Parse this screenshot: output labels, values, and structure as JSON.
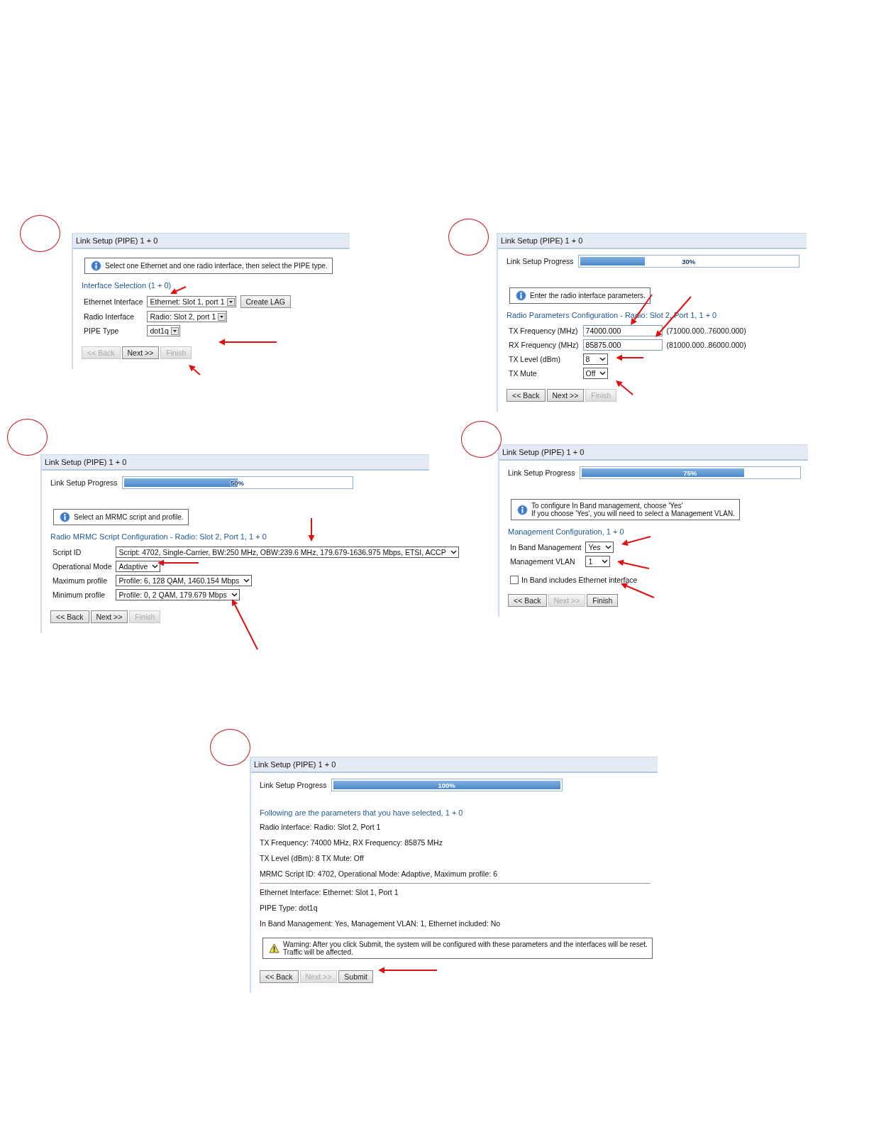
{
  "panels": [
    {
      "title": "Link Setup (PIPE) 1 + 0",
      "blocks": [
        {
          "kind": "info",
          "lines": [
            "Select one Ethernet and one radio interface, then select the PIPE type."
          ]
        },
        {
          "kind": "heading",
          "text": "Interface Selection (1 + 0)"
        },
        {
          "kind": "combo",
          "label": "Ethernet Interface",
          "value": "Ethernet: Slot 1, port 1",
          "action": "Create LAG"
        },
        {
          "kind": "combo",
          "label": "Radio Interface",
          "value": "Radio: Slot 2, port 1"
        },
        {
          "kind": "combo",
          "label": "PIPE Type",
          "value": "dot1q"
        }
      ],
      "buttons": [
        {
          "label": "<< Back",
          "disabled": true
        },
        {
          "label": "Next >>",
          "disabled": false
        },
        {
          "label": "Finish",
          "disabled": true
        }
      ]
    },
    {
      "title": "Link Setup (PIPE) 1 + 0",
      "progress": {
        "label": "Link Setup Progress",
        "text": "30%",
        "level": 0.3
      },
      "blocks": [
        {
          "kind": "info",
          "lines": [
            "Enter the radio interface parameters."
          ]
        },
        {
          "kind": "heading",
          "text": "Radio Parameters Configuration - Radio: Slot 2, Port 1, 1 + 0"
        },
        {
          "kind": "input",
          "label": "TX Frequency (MHz)",
          "value": "74000.000",
          "hint": "(71000.000..76000.000)"
        },
        {
          "kind": "input",
          "label": "RX Frequency (MHz)",
          "value": "85875.000",
          "hint": "(81000.000..86000.000)"
        },
        {
          "kind": "select",
          "label": "TX Level (dBm)",
          "value": "8"
        },
        {
          "kind": "select",
          "label": "TX Mute",
          "value": "Off"
        }
      ],
      "buttons": [
        {
          "label": "<< Back",
          "disabled": false
        },
        {
          "label": "Next >>",
          "disabled": false
        },
        {
          "label": "Finish",
          "disabled": true
        }
      ]
    },
    {
      "title": "Link Setup (PIPE) 1 + 0",
      "progress": {
        "label": "Link Setup Progress",
        "text": "50%",
        "level": 0.5
      },
      "blocks": [
        {
          "kind": "info",
          "lines": [
            "Select an MRMC script and profile."
          ]
        },
        {
          "kind": "heading",
          "text": "Radio MRMC Script Configuration - Radio: Slot 2, Port 1, 1 + 0"
        },
        {
          "kind": "select",
          "label": "Script ID",
          "value": "Script: 4702, Single-Carrier, BW:250 MHz, OBW:239.6 MHz, 179.679-1636.975 Mbps, ETSI, ACCP"
        },
        {
          "kind": "select",
          "label": "Operational Mode",
          "value": "Adaptive"
        },
        {
          "kind": "select",
          "label": "Maximum profile",
          "value": "Profile: 6, 128 QAM, 1460.154 Mbps"
        },
        {
          "kind": "select",
          "label": "Minimum profile",
          "value": "Profile: 0, 2 QAM, 179.679 Mbps"
        }
      ],
      "buttons": [
        {
          "label": "<< Back",
          "disabled": false
        },
        {
          "label": "Next >>",
          "disabled": false
        },
        {
          "label": "Finish",
          "disabled": true
        }
      ]
    },
    {
      "title": "Link Setup (PIPE) 1 + 0",
      "progress": {
        "label": "Link Setup Progress",
        "text": "75%",
        "level": 0.75
      },
      "blocks": [
        {
          "kind": "info",
          "lines": [
            "To configure In Band management, choose 'Yes'",
            "If you choose 'Yes', you will need to select a Management VLAN."
          ]
        },
        {
          "kind": "heading",
          "text": "Management Configuration, 1 + 0"
        },
        {
          "kind": "select",
          "label": "In Band Management",
          "value": "Yes"
        },
        {
          "kind": "select",
          "label": "Management VLAN",
          "value": "1"
        },
        {
          "kind": "checkbox",
          "label": "In Band includes Ethernet interface",
          "checked": false
        }
      ],
      "buttons": [
        {
          "label": "<< Back",
          "disabled": false
        },
        {
          "label": "Next >>",
          "disabled": true
        },
        {
          "label": "Finish",
          "disabled": false
        }
      ]
    },
    {
      "title": "Link Setup (PIPE) 1 + 0",
      "progress": {
        "label": "Link Setup Progress",
        "text": "100%",
        "level": 1
      },
      "blocks": [
        {
          "kind": "heading",
          "text": "Following are the parameters that you have selected, 1 + 0"
        },
        {
          "kind": "line",
          "text": "Radio interface: Radio: Slot 2, Port 1"
        },
        {
          "kind": "line",
          "text": "TX Frequency: 74000 MHz, RX Frequency: 85875 MHz"
        },
        {
          "kind": "line",
          "text": "TX Level (dBm): 8 TX Mute: Off"
        },
        {
          "kind": "line",
          "text": "MRMC Script ID: 4702, Operational Mode: Adaptive, Maximum profile: 6"
        },
        {
          "kind": "divider"
        },
        {
          "kind": "line",
          "text": "Ethernet Interface: Ethernet: Slot 1, Port 1"
        },
        {
          "kind": "line",
          "text": "PIPE Type: dot1q"
        },
        {
          "kind": "line",
          "text": "In Band Management: Yes, Management VLAN: 1, Ethernet included: No"
        },
        {
          "kind": "warning",
          "lines": [
            "Warning: After you click Submit, the system will be configured with these parameters and the interfaces will be reset.",
            "Traffic will be affected."
          ]
        }
      ],
      "buttons": [
        {
          "label": "<< Back",
          "disabled": false
        },
        {
          "label": "Next >>",
          "disabled": true
        },
        {
          "label": "Submit",
          "disabled": false
        }
      ]
    }
  ]
}
